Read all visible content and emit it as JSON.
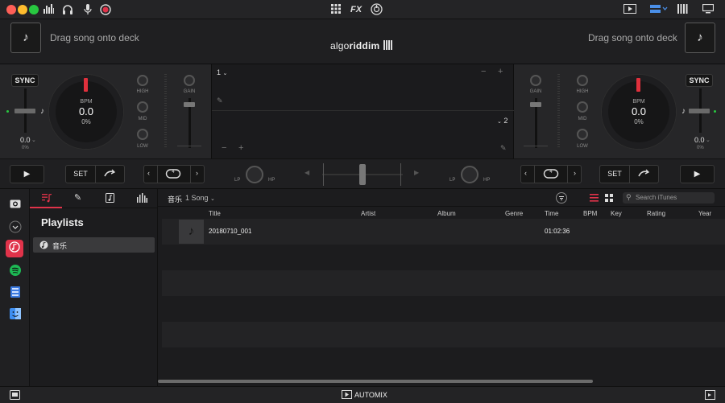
{
  "titlebar": {
    "traffic": [
      "#fe5f57",
      "#febc2e",
      "#28c840"
    ],
    "left_icons": [
      "equalizer-icon",
      "headphones-icon",
      "microphone-icon",
      "record-icon"
    ],
    "center_icons": [
      "grid-icon",
      "fx-icon",
      "sampler-icon"
    ],
    "fx_label": "FX",
    "right_icons": [
      "video-icon",
      "layout-icon",
      "mixer-icon",
      "display-icon"
    ]
  },
  "deck_header": {
    "left_placeholder": "Drag song onto deck",
    "right_placeholder": "Drag song onto deck",
    "logo": "algoriddim",
    "logo_light": "algo",
    "logo_bold": "riddim"
  },
  "deck_left": {
    "sync": "SYNC",
    "bpm_label": "BPM",
    "bpm_value": "0.0",
    "pct": "0%",
    "pitch_value": "0.0",
    "pitch_pct": "0%",
    "eq": [
      "HIGH",
      "MID",
      "LOW"
    ],
    "gain": "GAIN"
  },
  "deck_right": {
    "sync": "SYNC",
    "bpm_label": "BPM",
    "bpm_value": "0.0",
    "pct": "0%",
    "pitch_value": "0.0",
    "pitch_pct": "0%",
    "eq": [
      "HIGH",
      "MID",
      "LOW"
    ],
    "gain": "GAIN"
  },
  "center": {
    "deck1_label": "1",
    "deck2_label": "2"
  },
  "transport": {
    "set_left": "SET",
    "set_right": "SET",
    "loop_left": "4",
    "loop_right": "4",
    "lp": "LP",
    "hp": "HP"
  },
  "sidebar": {
    "icons": [
      "camera-icon",
      "chevron-down-icon",
      "music-icon",
      "spotify-icon",
      "video-file-icon",
      "finder-icon"
    ],
    "accent": "#e0334a",
    "spotify": "#1db954"
  },
  "library": {
    "tabs": [
      "playlist-tab",
      "edit-tab",
      "music-file-tab",
      "waveform-tab"
    ],
    "title": "Playlists",
    "items": [
      {
        "label": "音乐",
        "selected": true
      }
    ]
  },
  "tracklist": {
    "breadcrumb": "音乐",
    "count": "1 Song",
    "search_placeholder": "Search iTunes",
    "columns": [
      "Title",
      "Artist",
      "Album",
      "Genre",
      "Time",
      "BPM",
      "Key",
      "Rating",
      "Year"
    ],
    "rows": [
      {
        "title": "20180710_001",
        "artist": "",
        "album": "",
        "genre": "",
        "time": "01:02:36",
        "bpm": "",
        "key": "",
        "rating": "",
        "year": ""
      }
    ]
  },
  "bottombar": {
    "automix": "AUTOMIX"
  }
}
